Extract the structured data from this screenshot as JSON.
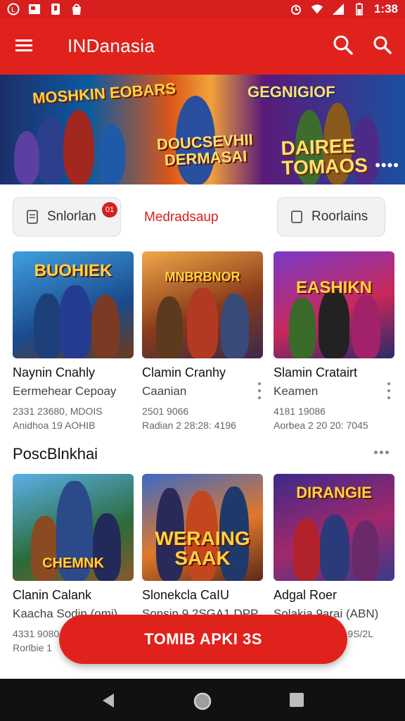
{
  "status_bar": {
    "time": "1:38"
  },
  "app_bar": {
    "title": "INDanasia"
  },
  "banner": {
    "title_left": "MOSHKIN EOBARS",
    "title_center": "DOUCSEVHII DERMASAI",
    "title_right_top": "GEGNIGIOF",
    "title_right": "DAIREE TOMAOS"
  },
  "filters": {
    "chip_left": {
      "label": "Snlorlan",
      "badge": "01"
    },
    "active": "Medradsaup",
    "chip_right": {
      "label": "Roorlains"
    }
  },
  "games_row1": [
    {
      "logo": "BUOHIEK",
      "name": "Naynin Cnahly",
      "sub": "Eermehear Cepoay",
      "meta1": "2331 23680, MDOIS",
      "meta2": "Anidhoa 19 AOHIB"
    },
    {
      "logo": "MNBRBNOR",
      "name": "Clamin Cranhy",
      "sub": "Caanian",
      "meta1": "2501 9066",
      "meta2": "Radian 2 28:28: 4196"
    },
    {
      "logo": "EASHIKN",
      "name": "Slamin Cratairt",
      "sub": "Keamen",
      "meta1": "4181 19086",
      "meta2": "Aorbea 2 20 20: 7045"
    }
  ],
  "section": {
    "title": "PoscBlnkhai"
  },
  "games_row2": [
    {
      "logo": "CHEMNK",
      "name": "Clanin Calank",
      "sub": "Kaacha Sodin (omi)",
      "meta1": "4331 9080",
      "meta2": "Rorlbie 1"
    },
    {
      "logo": "WERAING SAAK",
      "name": "Slonekcla CaIU",
      "sub": "Sonsin 9 2SGA1 DPP",
      "meta1": "",
      "meta2": ""
    },
    {
      "logo": "DIRANGIE",
      "name": "Adgal Roer",
      "sub": "Solakia 9arai (ABN)",
      "meta1": "",
      "meta2": "9S/2L"
    }
  ],
  "install_button": {
    "label": "TOMIB APKI 3S"
  },
  "colors": {
    "primary": "#e1221c",
    "status": "#d71f1f"
  }
}
